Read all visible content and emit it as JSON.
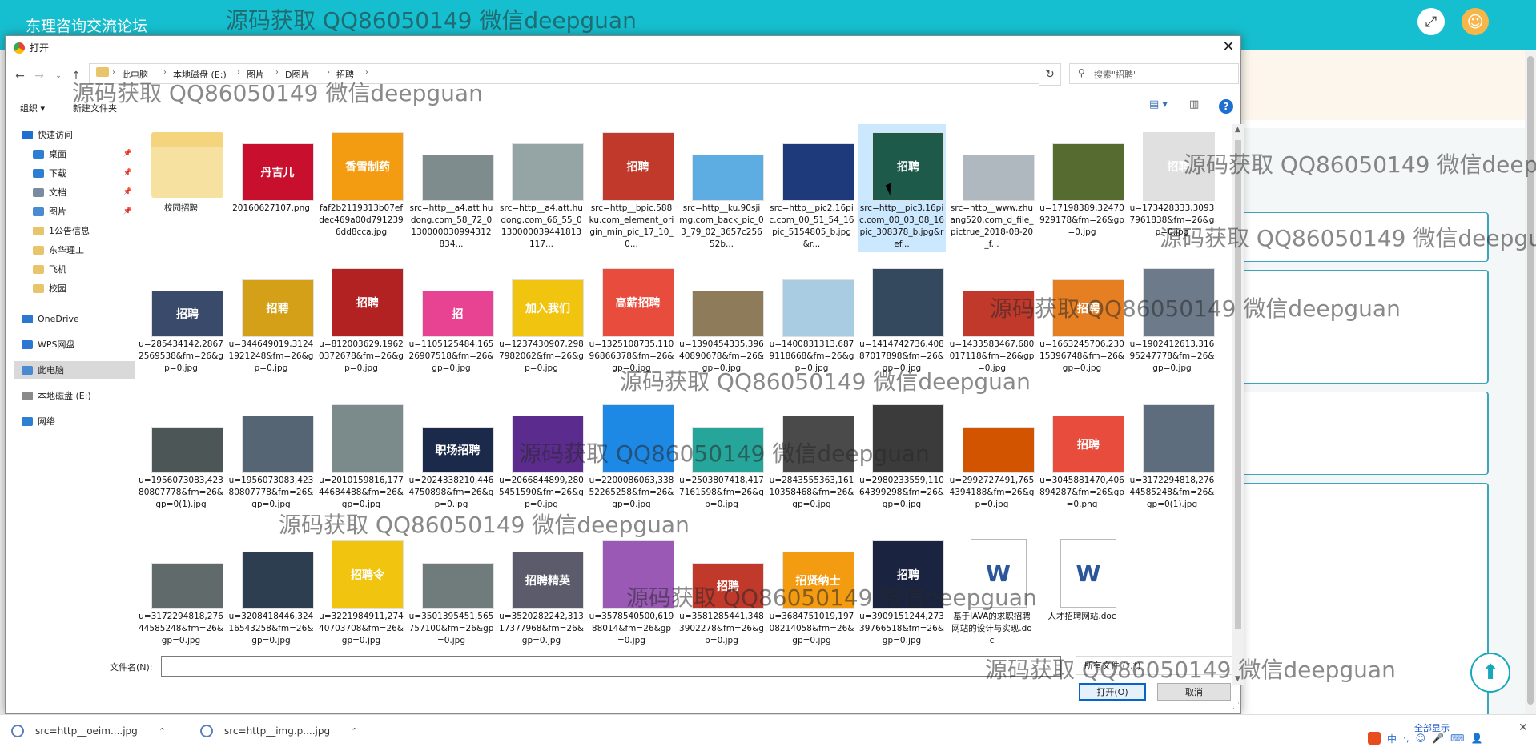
{
  "site": {
    "title": "东理咨询交流论坛"
  },
  "watermark": "源码获取 QQ86050149 微信deepguan",
  "dialog": {
    "title": "打开",
    "breadcrumbs": [
      "此电脑",
      "本地磁盘 (E:)",
      "图片",
      "D图片",
      "招聘"
    ],
    "search_placeholder": "搜索\"招聘\"",
    "organize": "组织 ▾",
    "new_folder": "新建文件夹",
    "nav": [
      {
        "label": "快速访问",
        "icon": "star-icon",
        "color": "#1e6fd0",
        "indent": 0,
        "pinned": false
      },
      {
        "label": "桌面",
        "icon": "desktop-icon",
        "color": "#2d7fd3",
        "indent": 1,
        "pinned": true
      },
      {
        "label": "下载",
        "icon": "download-icon",
        "color": "#2d7fd3",
        "indent": 1,
        "pinned": true
      },
      {
        "label": "文档",
        "icon": "document-icon",
        "color": "#7a8aa0",
        "indent": 1,
        "pinned": true
      },
      {
        "label": "图片",
        "icon": "pictures-icon",
        "color": "#4a8ad0",
        "indent": 1,
        "pinned": true
      },
      {
        "label": "1公告信息",
        "icon": "folder-icon",
        "color": "#e8c46a",
        "indent": 1,
        "pinned": false
      },
      {
        "label": "东华理工",
        "icon": "folder-icon",
        "color": "#e8c46a",
        "indent": 1,
        "pinned": false
      },
      {
        "label": "飞机",
        "icon": "folder-icon",
        "color": "#e8c46a",
        "indent": 1,
        "pinned": false
      },
      {
        "label": "校园",
        "icon": "folder-icon",
        "color": "#e8c46a",
        "indent": 1,
        "pinned": false
      },
      {
        "label": "OneDrive",
        "icon": "cloud-icon",
        "color": "#2b78d4",
        "indent": 0,
        "pinned": false
      },
      {
        "label": "WPS网盘",
        "icon": "cloud-icon",
        "color": "#2b78d4",
        "indent": 0,
        "pinned": false
      },
      {
        "label": "此电脑",
        "icon": "computer-icon",
        "color": "#4a8ad0",
        "indent": 0,
        "pinned": false,
        "selected": true
      },
      {
        "label": "本地磁盘 (E:)",
        "icon": "drive-icon",
        "color": "#8a8a8a",
        "indent": 0,
        "pinned": false
      },
      {
        "label": "网络",
        "icon": "network-icon",
        "color": "#2d7fd3",
        "indent": 0,
        "pinned": false
      }
    ],
    "files": [
      {
        "name": "校园招聘",
        "kind": "folder",
        "color": "#f4d47c"
      },
      {
        "name": "20160627107.png",
        "color": "#c8102e",
        "thumb_text": "丹吉儿"
      },
      {
        "name": "faf2b2119313b07efdec469a00d7912396dd8cca.jpg",
        "color": "#f39c12",
        "thumb_text": "香雪制药"
      },
      {
        "name": "src=http__a4.att.hudong.com_58_72_0130000030994312834...",
        "color": "#7f8c8d"
      },
      {
        "name": "src=http__a4.att.hudong.com_66_55_0130000039441813117...",
        "color": "#95a5a6"
      },
      {
        "name": "src=http__bpic.588ku.com_element_origin_min_pic_17_10_0...",
        "color": "#c0392b",
        "thumb_text": "招聘"
      },
      {
        "name": "src=http__ku.90sjimg.com_back_pic_03_79_02_3657c25652b...",
        "color": "#5dade2"
      },
      {
        "name": "src=http__pic2.16pic.com_00_51_54_16pic_5154805_b.jpg&r...",
        "color": "#1f3a7a"
      },
      {
        "name": "src=http__pic3.16pic.com_00_03_08_16pic_308378_b.jpg&ref...",
        "color": "#1e5a4a",
        "thumb_text": "招聘",
        "selected": true
      },
      {
        "name": "src=http__www.zhuang520.com_d_file_pictrue_2018-08-20_f...",
        "color": "#b0b8bf"
      },
      {
        "name": "u=17198389,32470929178&fm=26&gp=0.jpg",
        "color": "#556b2f"
      },
      {
        "name": "u=173428333,30937961838&fm=26&gp=0.jpg",
        "color": "#e0e0e0",
        "thumb_text": "招聘"
      },
      {
        "name": "u=285434142,28672569538&fm=26&gp=0.jpg",
        "color": "#3a4a6a",
        "thumb_text": "招聘"
      },
      {
        "name": "u=344649019,31241921248&fm=26&gp=0.jpg",
        "color": "#d4a017",
        "thumb_text": "招聘"
      },
      {
        "name": "u=812003629,19620372678&fm=26&gp=0.jpg",
        "color": "#b22222",
        "thumb_text": "招聘"
      },
      {
        "name": "u=1105125484,16526907518&fm=26&gp=0.jpg",
        "color": "#e84393",
        "thumb_text": "招"
      },
      {
        "name": "u=1237430907,2987982062&fm=26&gp=0.jpg",
        "color": "#f1c40f",
        "thumb_text": "加入我们"
      },
      {
        "name": "u=1325108735,11096866378&fm=26&gp=0.jpg",
        "color": "#e74c3c",
        "thumb_text": "高薪招聘"
      },
      {
        "name": "u=1390454335,39640890678&fm=26&gp=0.jpg",
        "color": "#8e7b5a"
      },
      {
        "name": "u=1400831313,6879118668&fm=26&gp=0.jpg",
        "color": "#a9cce3"
      },
      {
        "name": "u=1414742736,40887017898&fm=26&gp=0.jpg",
        "color": "#34495e"
      },
      {
        "name": "u=1433583467,680017118&fm=26&gp=0.jpg",
        "color": "#c0392b"
      },
      {
        "name": "u=1663245706,23015396748&fm=26&gp=0.jpg",
        "color": "#e67e22",
        "thumb_text": "招聘"
      },
      {
        "name": "u=1902412613,31695247778&fm=26&gp=0.jpg",
        "color": "#6c7a89"
      },
      {
        "name": "u=1956073083,42380807778&fm=26&gp=0(1).jpg",
        "color": "#4d5656"
      },
      {
        "name": "u=1956073083,42380807778&fm=26&gp=0.jpg",
        "color": "#566573"
      },
      {
        "name": "u=2010159816,17744684488&fm=26&gp=0.jpg",
        "color": "#7b8a8b"
      },
      {
        "name": "u=2024338210,4464750898&fm=26&gp=0.jpg",
        "color": "#1b2a4a",
        "thumb_text": "职场招聘"
      },
      {
        "name": "u=2066844899,2805451590&fm=26&gp=0.jpg",
        "color": "#5b2c8e"
      },
      {
        "name": "u=2200086063,33852265258&fm=26&gp=0.jpg",
        "color": "#1e88e5"
      },
      {
        "name": "u=2503807418,4177161598&fm=26&gp=0.jpg",
        "color": "#26a69a"
      },
      {
        "name": "u=2843555363,16110358468&fm=26&gp=0.jpg",
        "color": "#4a4a4a"
      },
      {
        "name": "u=2980233559,11064399298&fm=26&gp=0.jpg",
        "color": "#3b3b3b"
      },
      {
        "name": "u=2992727491,7654394188&fm=26&gp=0.jpg",
        "color": "#d35400"
      },
      {
        "name": "u=3045881470,406894287&fm=26&gp=0.png",
        "color": "#e74c3c",
        "thumb_text": "招聘"
      },
      {
        "name": "u=3172294818,27644585248&fm=26&gp=0(1).jpg",
        "color": "#5d6d7e"
      },
      {
        "name": "u=3172294818,27644585248&fm=26&gp=0.jpg",
        "color": "#616a6b"
      },
      {
        "name": "u=3208418446,32416543258&fm=26&gp=0.jpg",
        "color": "#2c3e50"
      },
      {
        "name": "u=3221984911,27440703708&fm=26&gp=0.jpg",
        "color": "#f1c40f",
        "thumb_text": "招聘令"
      },
      {
        "name": "u=3501395451,565757100&fm=26&gp=0.jpg",
        "color": "#707b7c"
      },
      {
        "name": "u=3520282242,31317377968&fm=26&gp=0.jpg",
        "color": "#5b5b6b",
        "thumb_text": "招聘精英"
      },
      {
        "name": "u=3578540500,61988014&fm=26&gp=0.jpg",
        "color": "#9b59b6"
      },
      {
        "name": "u=3581285441,3483902278&fm=26&gp=0.jpg",
        "color": "#c0392b",
        "thumb_text": "招聘"
      },
      {
        "name": "u=3684751019,19708214058&fm=26&gp=0.jpg",
        "color": "#f39c12",
        "thumb_text": "招贤纳士"
      },
      {
        "name": "u=3909151244,27339766518&fm=26&gp=0.jpg",
        "color": "#1a2440",
        "thumb_text": "招聘"
      },
      {
        "name": "基于JAVA的求职招聘网站的设计与实现.doc",
        "kind": "doc",
        "color": "#2b579a"
      },
      {
        "name": "人才招聘网站.doc",
        "kind": "doc",
        "color": "#2b579a"
      }
    ],
    "filename_label": "文件名(N):",
    "filename_value": "",
    "filter": "所有文件 (*.*)",
    "open_label": "打开(O)",
    "cancel_label": "取消"
  },
  "downloads": [
    {
      "name": "src=http__oeim....jpg"
    },
    {
      "name": "src=http__img.p....jpg"
    }
  ],
  "downloads_show_all": "全部显示",
  "tray": {
    "ime": "中",
    "punct": "·,"
  }
}
